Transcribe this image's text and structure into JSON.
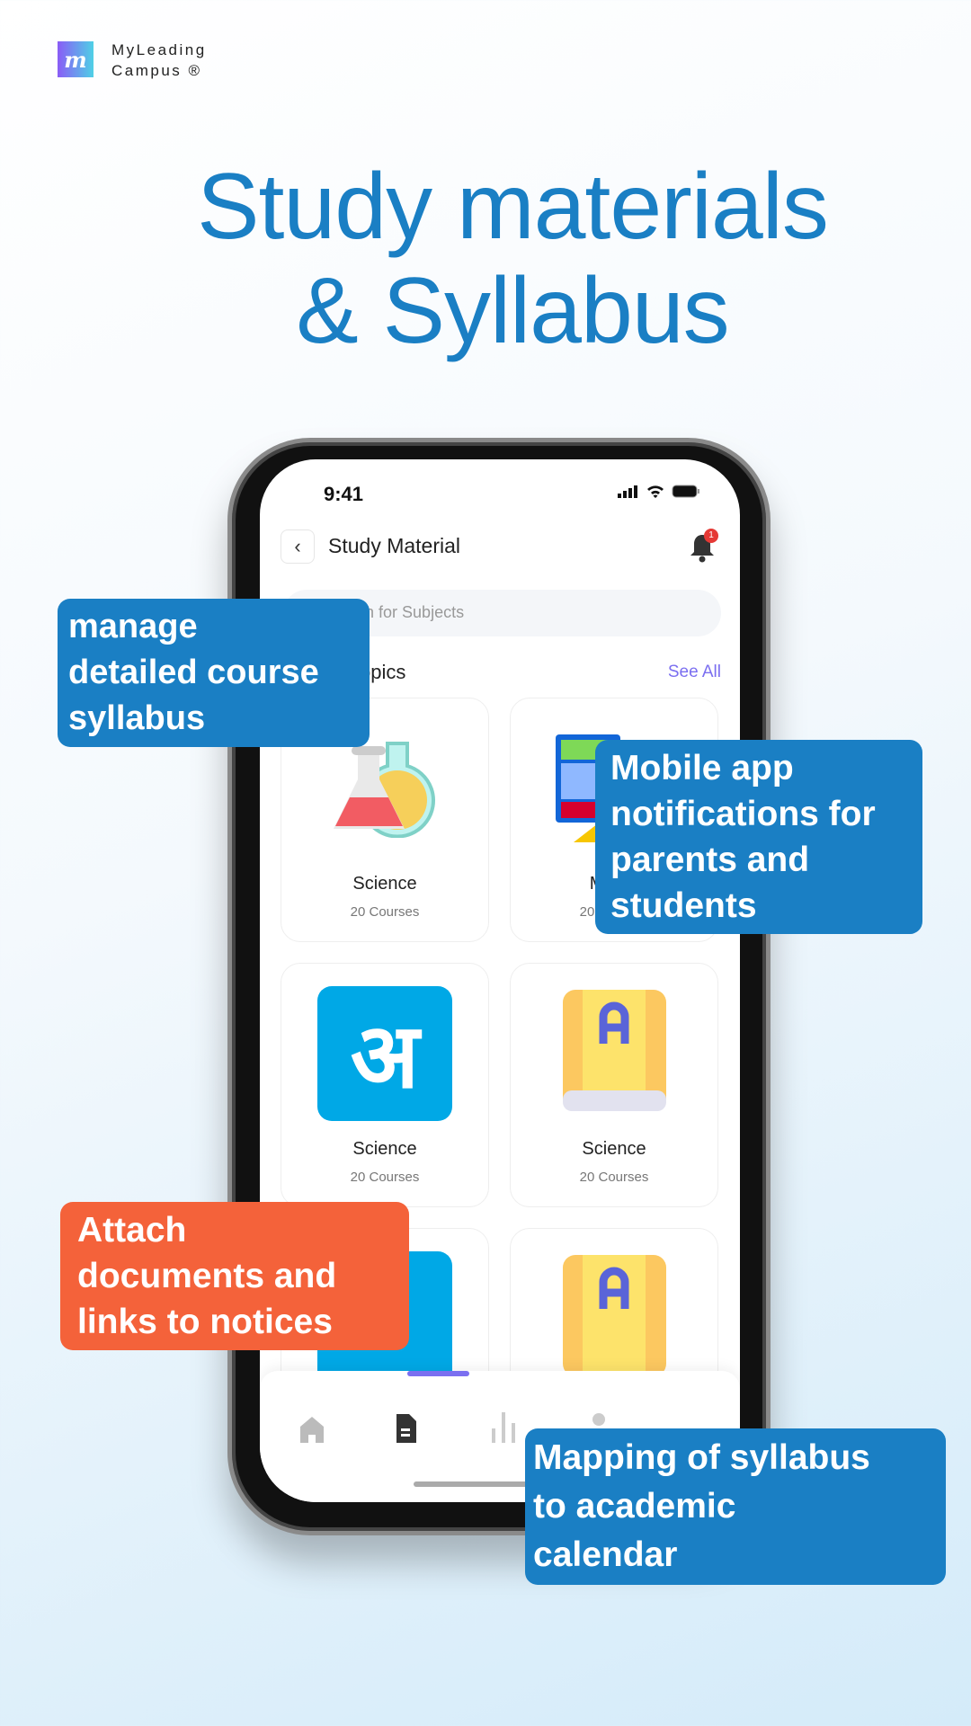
{
  "brand": {
    "line1": "MyLeading",
    "line2": "Campus ®",
    "logo_letter": "m"
  },
  "headline": {
    "line1": "Study materials",
    "line2": "& Syllabus",
    "color": "#1a7fc4"
  },
  "phone": {
    "status": {
      "time": "9:41",
      "icons": [
        "signal-icon",
        "wifi-icon",
        "battery-icon"
      ]
    },
    "header": {
      "title": "Study Material",
      "notification_count": "1"
    },
    "search": {
      "placeholder": "Search for Subjects"
    },
    "section": {
      "title": "Topics",
      "see_all": "See All"
    },
    "cards": [
      {
        "label": "Science",
        "sub": "20 Courses",
        "icon": "flasks-icon"
      },
      {
        "label": "Maths",
        "sub": "20 Courses",
        "icon": "calculator-icon"
      },
      {
        "label": "Science",
        "sub": "20 Courses",
        "icon": "hindi-letter-icon"
      },
      {
        "label": "Science",
        "sub": "20 Courses",
        "icon": "book-icon"
      },
      {
        "label": "",
        "sub": "",
        "icon": "hindi-letter-icon"
      },
      {
        "label": "",
        "sub": "",
        "icon": "book-icon"
      }
    ],
    "nav": [
      "home-icon",
      "document-icon",
      "chart-icon",
      "profile-icon"
    ],
    "accent": "#7b6ff0"
  },
  "callouts": {
    "c1": [
      "manage",
      "detailed course",
      "syllabus"
    ],
    "c2": [
      "Mobile app",
      "notifications for",
      "parents and",
      "students"
    ],
    "c3": [
      "Attach",
      "documents and",
      "links to notices"
    ],
    "c4": [
      "Mapping of syllabus",
      "to academic",
      "calendar"
    ],
    "blue": "#1a7fc4",
    "orange": "#f4623a"
  }
}
